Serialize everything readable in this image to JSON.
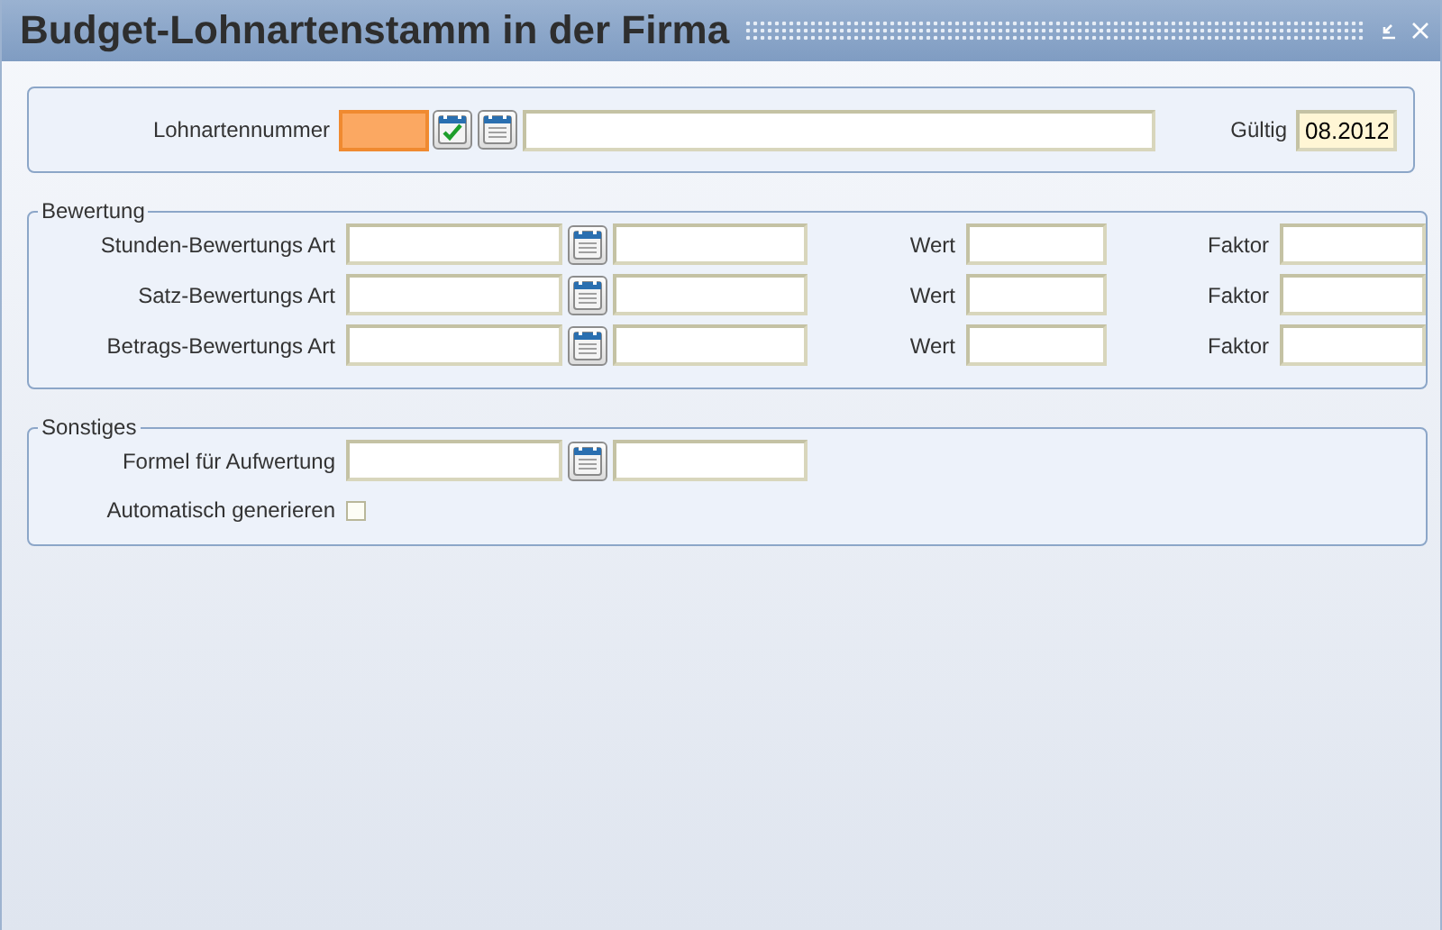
{
  "window": {
    "title": "Budget-Lohnartenstamm in der Firma"
  },
  "header": {
    "number": {
      "label": "Lohnartennummer",
      "focused": true
    },
    "valid": {
      "label": "Gültig",
      "value": "08.2012"
    }
  },
  "bewertung": {
    "legend": "Bewertung",
    "rows": [
      {
        "label": "Stunden-Bewertungs Art",
        "value_label": "Wert",
        "factor_label": "Faktor"
      },
      {
        "label": "Satz-Bewertungs Art",
        "value_label": "Wert",
        "factor_label": "Faktor"
      },
      {
        "label": "Betrags-Bewertungs Art",
        "value_label": "Wert",
        "factor_label": "Faktor"
      }
    ]
  },
  "sonstiges": {
    "legend": "Sonstiges",
    "formula": {
      "label": "Formel für Aufwertung"
    },
    "auto": {
      "label": "Automatisch generieren",
      "checked": false
    }
  }
}
